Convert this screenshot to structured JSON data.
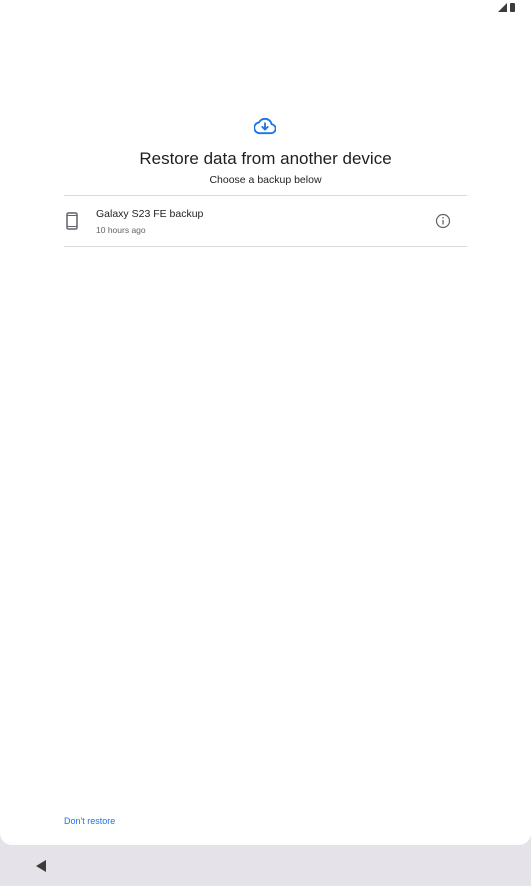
{
  "header": {
    "icon": "cloud-download-icon",
    "title": "Restore data from another device",
    "subtitle": "Choose a backup below"
  },
  "backups": [
    {
      "icon": "phone-icon",
      "name": "Galaxy S23 FE backup",
      "time": "10 hours ago",
      "action_icon": "info-icon"
    }
  ],
  "footer": {
    "dont_restore_label": "Don't restore"
  },
  "colors": {
    "accent": "#1a73e8",
    "background": "#ffffff",
    "nav_background": "#e6e2e9"
  }
}
